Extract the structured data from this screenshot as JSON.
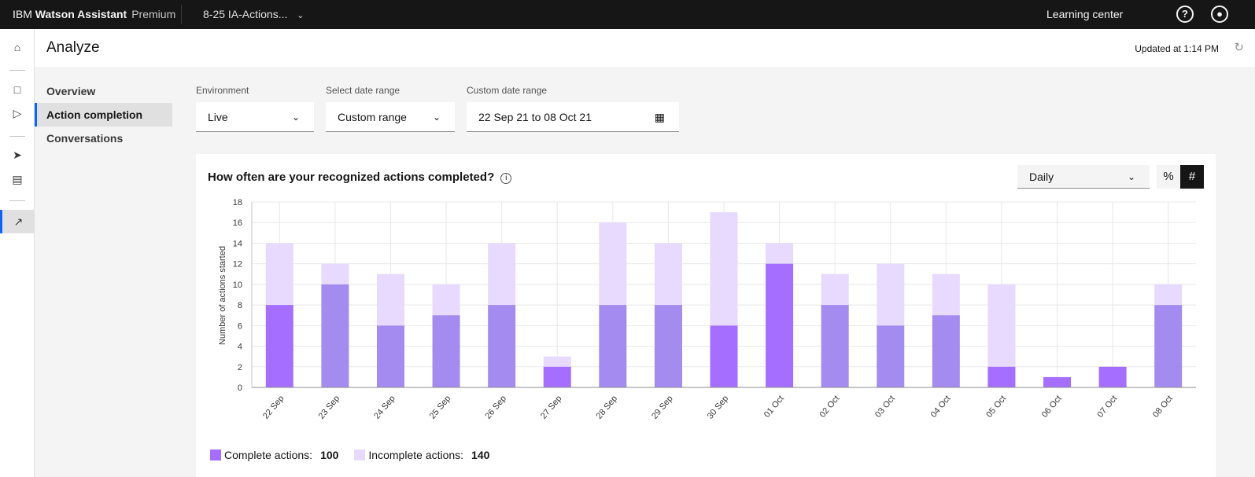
{
  "topbar": {
    "brand_ibm": "IBM",
    "brand_name": "Watson Assistant",
    "plan": "Premium",
    "project": "8-25 IA-Actions...",
    "learning_center": "Learning center",
    "help_icon": "help-icon",
    "user_icon": "user-avatar-icon"
  },
  "header": {
    "title": "Analyze",
    "updated": "Updated at 1:14 PM"
  },
  "nav": {
    "items": [
      {
        "label": "Overview"
      },
      {
        "label": "Action completion",
        "active": true
      },
      {
        "label": "Conversations"
      }
    ]
  },
  "filters": {
    "environment": {
      "label": "Environment",
      "value": "Live"
    },
    "date_range": {
      "label": "Select date range",
      "value": "Custom range"
    },
    "custom": {
      "label": "Custom date range",
      "value": "22 Sep 21 to 08 Oct 21"
    }
  },
  "card": {
    "title": "How often are your recognized actions completed?",
    "interval": "Daily",
    "percent_label": "%",
    "number_label": "#",
    "selected_toggle": "#"
  },
  "legend": {
    "complete_label": "Complete actions:",
    "complete_value": "100",
    "incomplete_label": "Incomplete actions:",
    "incomplete_value": "140"
  },
  "colors": {
    "complete": "#a56eff",
    "complete_alt": "#a38bef",
    "incomplete": "#e8daff"
  },
  "chart_data": {
    "type": "bar",
    "stacked": true,
    "ylabel": "Number of actions started",
    "ylim": [
      0,
      18
    ],
    "yticks": [
      0,
      2,
      4,
      6,
      8,
      10,
      12,
      14,
      16,
      18
    ],
    "grid": true,
    "legend": "bottom-left",
    "categories": [
      "22 Sep",
      "23 Sep",
      "24 Sep",
      "25 Sep",
      "26 Sep",
      "27 Sep",
      "28 Sep",
      "29 Sep",
      "30 Sep",
      "01 Oct",
      "02 Oct",
      "03 Oct",
      "04 Oct",
      "05 Oct",
      "06 Oct",
      "07 Oct",
      "08 Oct"
    ],
    "series": [
      {
        "name": "Complete actions",
        "values": [
          8,
          10,
          6,
          7,
          8,
          2,
          8,
          8,
          6,
          12,
          8,
          6,
          7,
          2,
          1,
          2,
          8
        ]
      },
      {
        "name": "Incomplete actions",
        "values": [
          6,
          2,
          5,
          3,
          6,
          1,
          8,
          6,
          11,
          2,
          3,
          6,
          4,
          8,
          0,
          0,
          2
        ]
      }
    ]
  }
}
